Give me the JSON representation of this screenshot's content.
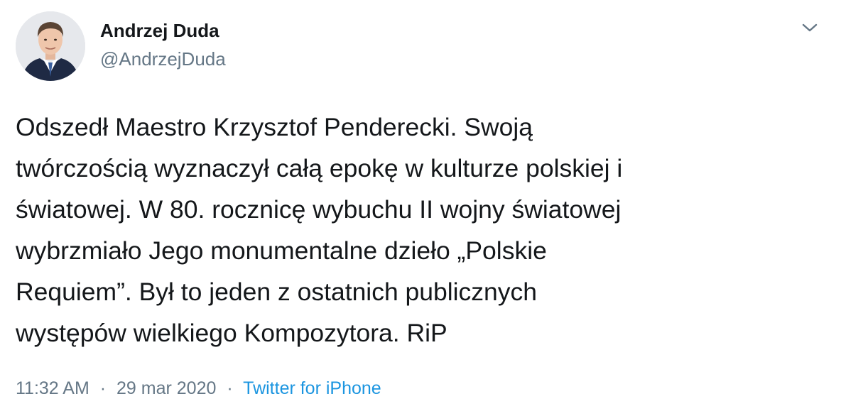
{
  "author": {
    "display_name": "Andrzej Duda",
    "handle": "@AndrzejDuda"
  },
  "tweet": {
    "text": "Odszedł Maestro Krzysztof Penderecki. Swoją\ntwórczością wyznaczył całą epokę w kulturze polskiej i\nświatowej. W 80. rocznicę wybuchu II wojny światowej\nwybrzmiało Jego monumentalne dzieło „Polskie\nRequiem”. Był to jeden z ostatnich publicznych\nwystępów wielkiego Kompozytora. RiP"
  },
  "meta": {
    "time": "11:32 AM",
    "separator": "·",
    "date": "29 mar 2020",
    "source": "Twitter for iPhone"
  },
  "icons": {
    "menu": "chevron-down-icon"
  },
  "colors": {
    "text": "#14171a",
    "secondary": "#657786",
    "link": "#1b95e0"
  }
}
